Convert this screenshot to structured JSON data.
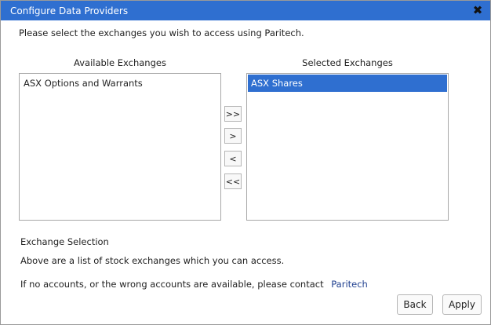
{
  "dialog": {
    "title": "Configure Data Providers",
    "close_icon": "close-icon",
    "intro": "Please select the exchanges you wish to access using Paritech."
  },
  "available": {
    "label": "Available Exchanges",
    "items": [
      "ASX Options and Warrants"
    ]
  },
  "selected": {
    "label": "Selected Exchanges",
    "items": [
      "ASX Shares"
    ]
  },
  "move_buttons": {
    "add_all": ">>",
    "add": ">",
    "remove": "<",
    "remove_all": "<<"
  },
  "info": {
    "section_title": "Exchange Selection",
    "text": "Above are a list of stock exchanges which you can access.",
    "contact_text": "If no accounts, or the wrong accounts are available, please contact",
    "contact_link": "Paritech"
  },
  "buttons": {
    "back": "Back",
    "apply": "Apply"
  },
  "colors": {
    "titlebar": "#2f6fd0",
    "selection": "#2f6fd0",
    "link": "#1f3f8f"
  }
}
